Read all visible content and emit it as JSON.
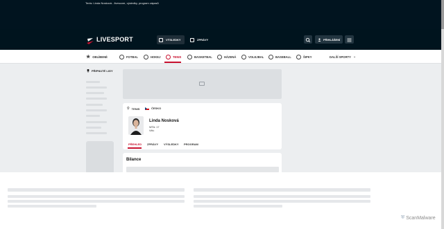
{
  "browser": {
    "tab_title": "Tenis: Linda Nosková - livescore, výsledky, program zápasů"
  },
  "header": {
    "logo_text": "LIVESPORT",
    "nav": [
      {
        "label": "VÝSLEDKY",
        "icon": "scores-icon",
        "active": true
      },
      {
        "label": "ZPRÁVY",
        "icon": "news-icon",
        "active": false
      }
    ],
    "login_label": "PŘIHLÁŠENÍ"
  },
  "sports": [
    {
      "label": "OBLÍBENÉ",
      "icon": "star-icon"
    },
    {
      "label": "FOTBAL",
      "icon": "football-icon"
    },
    {
      "label": "HOKEJ",
      "icon": "hockey-icon"
    },
    {
      "label": "TENIS",
      "icon": "tennis-icon",
      "active": true
    },
    {
      "label": "BASKETBAL",
      "icon": "basketball-icon"
    },
    {
      "label": "HÁZENÁ",
      "icon": "handball-icon"
    },
    {
      "label": "VOLEJBAL",
      "icon": "volleyball-icon"
    },
    {
      "label": "BASEBALL",
      "icon": "baseball-icon"
    },
    {
      "label": "ŠIPKY",
      "icon": "darts-icon"
    },
    {
      "label": "DALŠÍ SPORTY",
      "icon": "chevron-down-icon"
    }
  ],
  "sidebar": {
    "pinned_title": "PŘIPNUTÉ LIGY"
  },
  "breadcrumb": {
    "sport": "TENIS",
    "country": "ČESKO"
  },
  "player": {
    "name": "Linda Nosková",
    "rank_label": "WTA: 17",
    "age_label": "Věk:"
  },
  "player_tabs": [
    "PŘEHLED",
    "ZPRÁVY",
    "VÝSLEDKY",
    "PROGRAM"
  ],
  "section": {
    "title": "Bilance"
  },
  "watermark": "ScanMalware",
  "colors": {
    "accent": "#c8102e",
    "header_bg": "#00141e"
  }
}
